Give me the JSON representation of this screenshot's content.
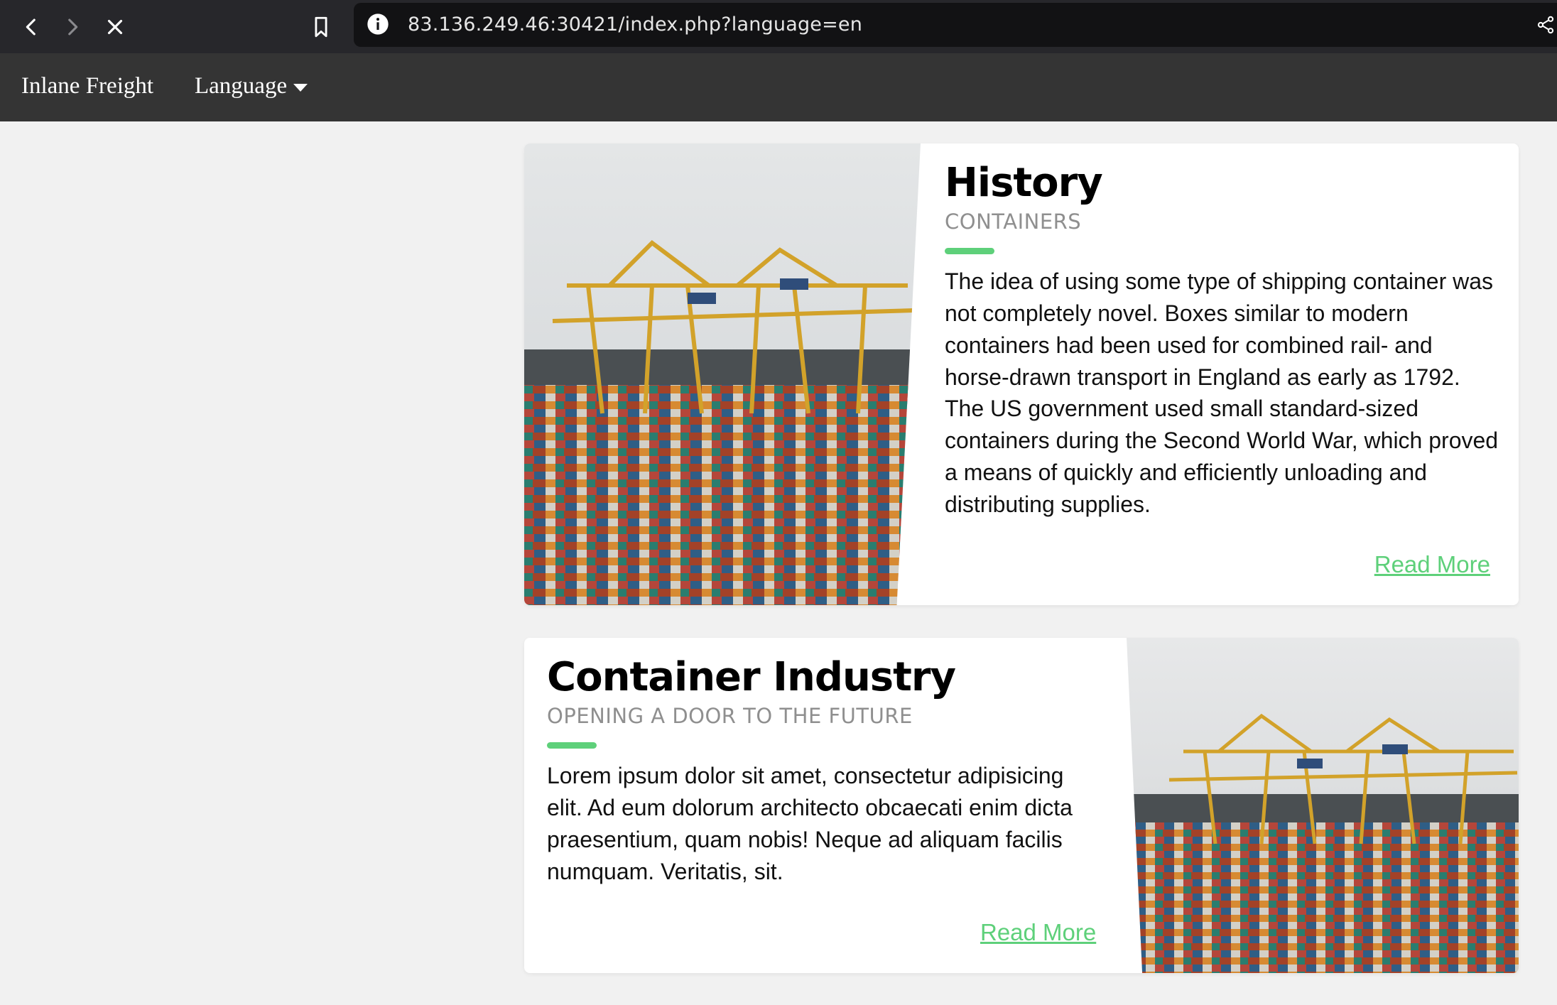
{
  "browser": {
    "url": "83.136.249.46:30421/index.php?language=en"
  },
  "navbar": {
    "brand": "Inlane Freight",
    "language_label": "Language"
  },
  "cards": [
    {
      "title": "History",
      "subtitle": "CONTAINERS",
      "body": "The idea of using some type of shipping container was not completely novel. Boxes similar to modern containers had been used for combined rail- and horse-drawn transport in England as early as 1792. The US government used small standard-sized containers during the Second World War, which proved a means of quickly and efficiently unloading and distributing supplies.",
      "link": "Read More"
    },
    {
      "title": "Container Industry",
      "subtitle": "OPENING A DOOR TO THE FUTURE",
      "body": "Lorem ipsum dolor sit amet, consectetur adipisicing elit. Ad eum dolorum architecto obcaecati enim dicta praesentium, quam nobis! Neque ad aliquam facilis numquam. Veritatis, sit.",
      "link": "Read More"
    }
  ],
  "colors": {
    "accent": "#5ed07a",
    "navbar": "#343434",
    "browser_bar": "#27272b",
    "page_bg": "#f1f1f1"
  }
}
